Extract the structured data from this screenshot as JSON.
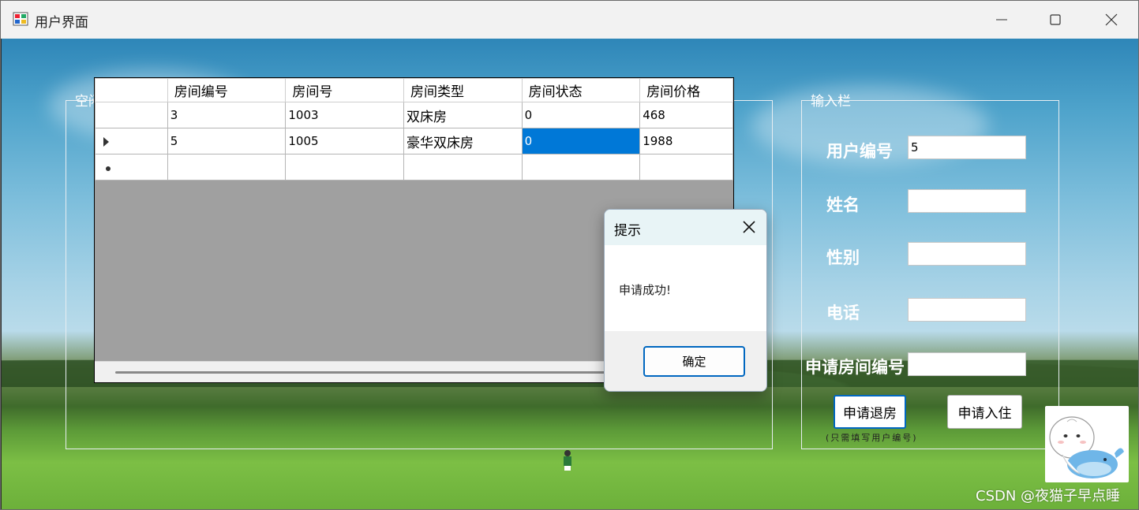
{
  "window": {
    "title": "用户界面"
  },
  "room_group": {
    "title": "空闲房间信息",
    "columns": [
      "房间编号",
      "房间号",
      "房间类型",
      "房间状态",
      "房间价格"
    ],
    "rows": [
      [
        "3",
        "1003",
        "双床房",
        "0",
        "468"
      ],
      [
        "5",
        "1005",
        "豪华双床房",
        "0",
        "1988"
      ]
    ]
  },
  "input_group": {
    "title": "输入栏",
    "user_id_label": "用户编号",
    "user_id_value": "5",
    "name_label": "姓名",
    "name_value": "",
    "gender_label": "性别",
    "gender_value": "",
    "phone_label": "电话",
    "phone_value": "",
    "room_id_label": "申请房间编号",
    "room_id_value": "",
    "checkout_button": "申请退房",
    "checkin_button": "申请入住",
    "hint": "(只需填写用户编号)"
  },
  "dialog": {
    "title": "提示",
    "message": "申请成功!",
    "ok_button": "确定"
  },
  "watermark": "CSDN @夜猫子早点睡",
  "colors": {
    "selection": "#0078d7",
    "titlebar": "#f2f2f2",
    "dialog_header": "#e8f4f6"
  }
}
